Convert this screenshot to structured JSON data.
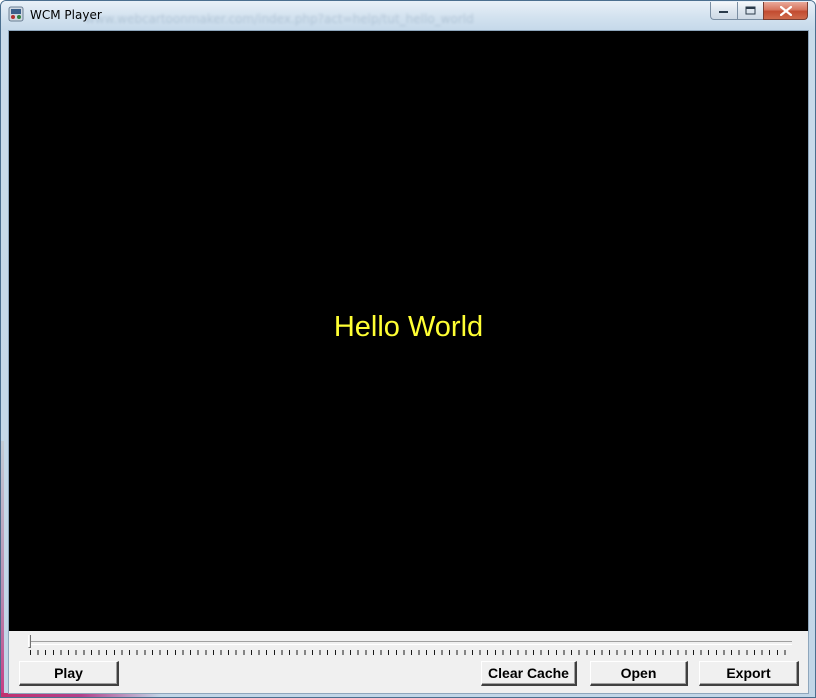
{
  "window": {
    "title": "WCM Player",
    "ghost_url": "www.webcartoonmaker.com/index.php?act=help/tut_hello_world"
  },
  "caption_buttons": {
    "minimize": "minimize-icon",
    "maximize": "maximize-icon",
    "close": "close-icon"
  },
  "stage": {
    "text": "Hello World",
    "background": "#000000",
    "text_color": "#ffff33"
  },
  "timeline": {
    "position": 0
  },
  "toolbar": {
    "play_label": "Play",
    "clear_cache_label": "Clear Cache",
    "open_label": "Open",
    "export_label": "Export"
  }
}
